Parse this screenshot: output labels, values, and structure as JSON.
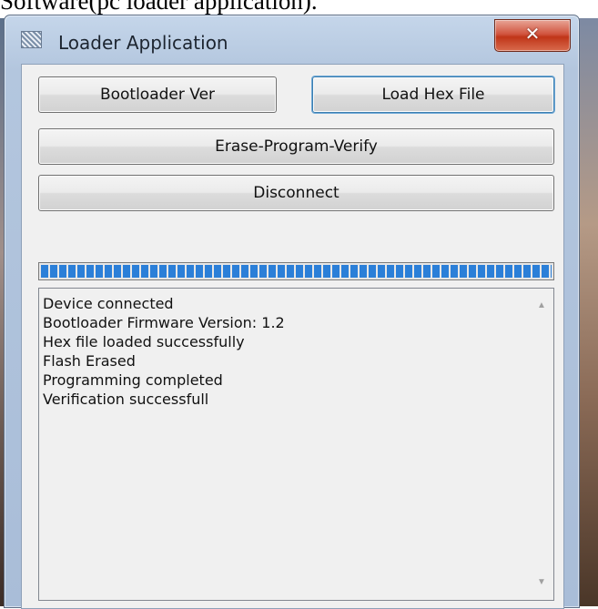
{
  "caption": "Software(pc loader application).",
  "window": {
    "title": "Loader Application",
    "app_icon": "loader-app-icon",
    "close_icon": "close-icon",
    "close_glyph": "✕"
  },
  "buttons": {
    "bootloader_ver": "Bootloader Ver",
    "load_hex_file": "Load Hex File",
    "erase_program_verify": "Erase-Program-Verify",
    "disconnect": "Disconnect"
  },
  "progress": {
    "value_percent": 100,
    "color": "#2b7fd8"
  },
  "log": {
    "lines": [
      "Device connected",
      "Bootloader Firmware Version: 1.2",
      "Hex file loaded successfully",
      "Flash Erased",
      "Programming completed",
      "Verification successfull"
    ],
    "scroll_up_icon": "scroll-up-arrow-icon",
    "scroll_down_icon": "scroll-down-arrow-icon",
    "scroll_up_glyph": "▲",
    "scroll_down_glyph": "▼"
  }
}
